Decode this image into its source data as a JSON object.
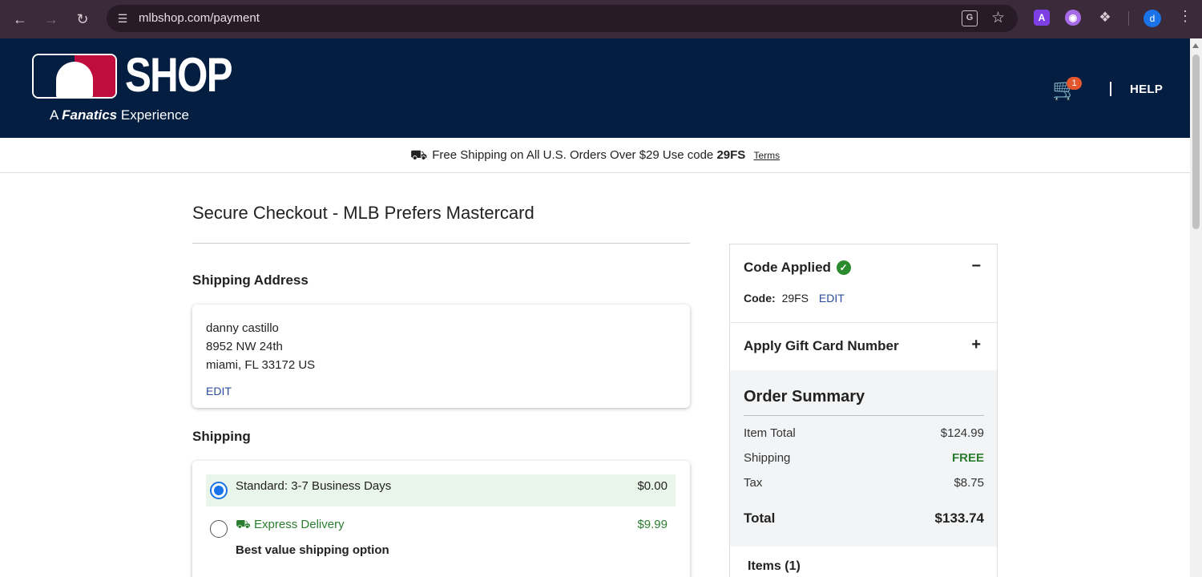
{
  "browser": {
    "url": "mlbshop.com/payment",
    "profile_initial": "d",
    "ext_a_label": "A"
  },
  "header": {
    "logo_text": "SHOP",
    "logo_tagline_prefix": "A",
    "logo_tagline_brand": "Fanatics",
    "logo_tagline_suffix": "Experience",
    "cart_count": "1",
    "help_label": "HELP"
  },
  "promo": {
    "text": "Free Shipping on All U.S. Orders Over $29 Use code",
    "code": "29FS",
    "terms_label": "Terms"
  },
  "checkout": {
    "title": "Secure Checkout - MLB Prefers Mastercard",
    "shipping_address_heading": "Shipping Address",
    "address": {
      "name": "danny castillo",
      "street": "8952 NW 24th",
      "city_line": "miami, FL 33172 US",
      "edit_label": "EDIT"
    },
    "shipping_heading": "Shipping",
    "shipping_options": [
      {
        "label": "Standard: 3-7 Business Days",
        "price": "$0.00",
        "selected": true
      },
      {
        "label": "Express Delivery",
        "price": "$9.99",
        "selected": false,
        "subtitle": "Best value shipping option"
      }
    ]
  },
  "sidebar": {
    "code_applied_heading": "Code Applied",
    "code_label": "Code:",
    "code_value": "29FS",
    "code_edit_label": "EDIT",
    "collapse_symbol": "−",
    "gift_card_heading": "Apply Gift Card Number",
    "expand_symbol": "+",
    "summary": {
      "title": "Order Summary",
      "item_total_label": "Item Total",
      "item_total_value": "$124.99",
      "shipping_label": "Shipping",
      "shipping_value": "FREE",
      "tax_label": "Tax",
      "tax_value": "$8.75",
      "total_label": "Total",
      "total_value": "$133.74"
    },
    "items_heading": "Items (1)"
  },
  "colors": {
    "header_navy": "#041e42",
    "mlb_red": "#bf0d3e",
    "selected_green": "#e9f5e9",
    "free_green": "#2a7d2e",
    "link_blue": "#2b4c9a",
    "radio_blue": "#1a73e8",
    "cart_badge": "#e4572e"
  },
  "icons": [
    "back-icon",
    "forward-icon",
    "reload-icon",
    "site-info-icon",
    "translate-icon",
    "star-icon",
    "extensions-icon",
    "menu-icon",
    "cart-icon",
    "truck-icon",
    "check-circle-icon",
    "fast-truck-icon"
  ]
}
